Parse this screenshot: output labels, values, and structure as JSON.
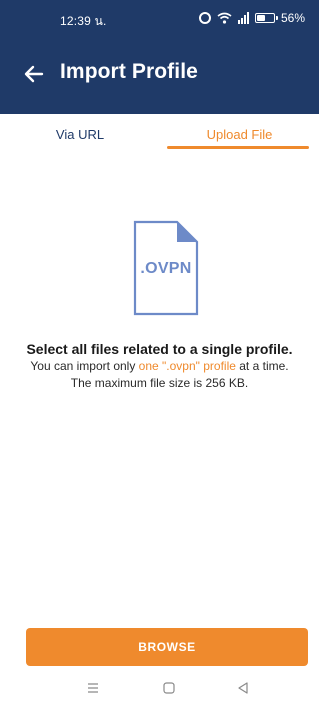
{
  "status_bar": {
    "time": "12:39 น.",
    "battery": "56%",
    "battery_level": 0.56,
    "icons": [
      "alarm-icon",
      "wifi-icon",
      "signal-icon",
      "battery-icon"
    ]
  },
  "app_bar": {
    "title": "Import Profile",
    "back_icon": "arrow-left-icon"
  },
  "tabs": [
    {
      "label": "Via URL",
      "selected": false
    },
    {
      "label": "Upload File",
      "selected": true
    }
  ],
  "illustration": {
    "label": ".OVPN",
    "icon": "file-icon"
  },
  "instructions": {
    "heading": "Select all files related to a single profile.",
    "line1_prefix": "You can import only ",
    "line1_highlight": "one \".ovpn\" profile",
    "line1_suffix": " at a time.",
    "line2": "The maximum file size is 256 KB."
  },
  "browse_button": {
    "label": "BROWSE"
  },
  "colors": {
    "header": "#1f3a68",
    "accent": "#ef8a2d",
    "file_icon": "#6d8ac8"
  },
  "system_nav": [
    "menu-icon",
    "home-icon",
    "back-triangle-icon"
  ]
}
